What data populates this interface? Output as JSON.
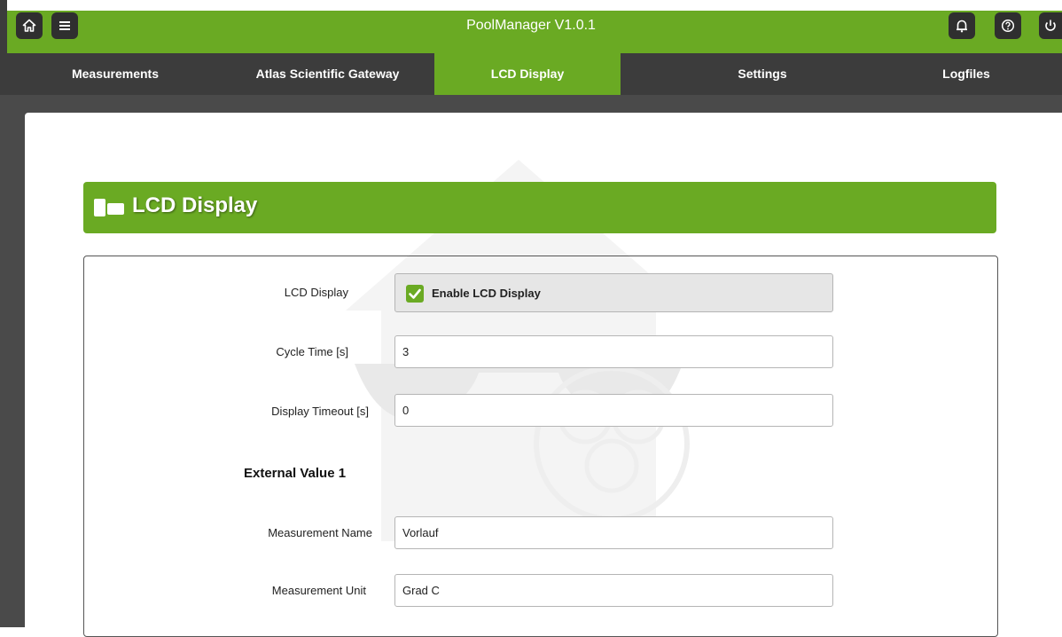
{
  "app": {
    "title": "PoolManager V1.0.1"
  },
  "toolbar": {
    "left_icons": [
      "home-icon",
      "menu-icon"
    ],
    "right_icons": [
      "bell-icon",
      "help-icon",
      "power-icon"
    ]
  },
  "nav": {
    "tabs": [
      {
        "label": "Measurements",
        "active": false
      },
      {
        "label": "Atlas Scientific Gateway",
        "active": false
      },
      {
        "label": "LCD Display",
        "active": true
      },
      {
        "label": "Settings",
        "active": false
      },
      {
        "label": "Logfiles",
        "active": false
      }
    ]
  },
  "section": {
    "title": "LCD Display",
    "icon": "lcd-display-icon"
  },
  "form": {
    "lcd_display": {
      "label": "LCD Display",
      "checkbox_label": "Enable LCD Display",
      "checked": true
    },
    "cycle_time": {
      "label": "Cycle Time [s]",
      "value": "3"
    },
    "display_timeout": {
      "label": "Display Timeout [s]",
      "value": "0"
    },
    "external_value_1": {
      "title": "External Value 1",
      "measurement_name": {
        "label": "Measurement Name",
        "value": "Vorlauf"
      },
      "measurement_unit": {
        "label": "Measurement Unit",
        "value": "Grad C"
      }
    }
  },
  "colors": {
    "accent": "#6aaa23",
    "dark": "#3c3c3c",
    "content_bg": "#4a4a4a"
  }
}
